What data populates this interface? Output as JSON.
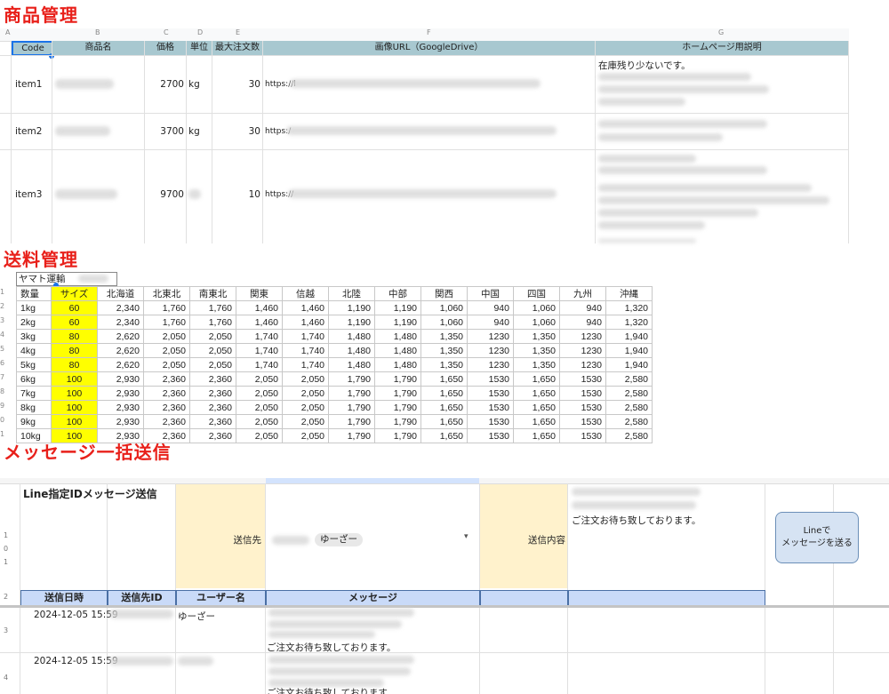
{
  "sections": {
    "product_title": "商品管理",
    "shipping_title": "送料管理",
    "message_title": "メッセージ一括送信"
  },
  "products": {
    "column_letters": [
      "A",
      "B",
      "C",
      "D",
      "E",
      "F",
      "G"
    ],
    "headers": [
      "Code",
      "商品名",
      "価格",
      "単位",
      "最大注文数",
      "画像URL（GoogleDrive）",
      "ホームページ用説明"
    ],
    "rows": [
      {
        "code": "item1",
        "price": "2700",
        "unit": "kg",
        "max": "30",
        "url": "https://l",
        "desc": "在庫残り少ないです。"
      },
      {
        "code": "item2",
        "price": "3700",
        "unit": "kg",
        "max": "30",
        "url": "https:/",
        "desc": ""
      },
      {
        "code": "item3",
        "price": "9700",
        "unit": "",
        "max": "10",
        "url": "https://",
        "desc": ""
      }
    ]
  },
  "shipping": {
    "carrier": "ヤマト運輸",
    "headers": [
      "数量",
      "サイズ",
      "北海道",
      "北東北",
      "南東北",
      "関東",
      "信越",
      "北陸",
      "中部",
      "関西",
      "中国",
      "四国",
      "九州",
      "沖縄"
    ],
    "row_numbers": [
      "1",
      "2",
      "3",
      "4",
      "5",
      "6",
      "7",
      "8",
      "9",
      "0",
      "1"
    ],
    "rows": [
      [
        "1kg",
        "60",
        "2,340",
        "1,760",
        "1,760",
        "1,460",
        "1,460",
        "1,190",
        "1,190",
        "1,060",
        "940",
        "1,060",
        "940",
        "1,320"
      ],
      [
        "2kg",
        "60",
        "2,340",
        "1,760",
        "1,760",
        "1,460",
        "1,460",
        "1,190",
        "1,190",
        "1,060",
        "940",
        "1,060",
        "940",
        "1,320"
      ],
      [
        "3kg",
        "80",
        "2,620",
        "2,050",
        "2,050",
        "1,740",
        "1,740",
        "1,480",
        "1,480",
        "1,350",
        "1230",
        "1,350",
        "1230",
        "1,940"
      ],
      [
        "4kg",
        "80",
        "2,620",
        "2,050",
        "2,050",
        "1,740",
        "1,740",
        "1,480",
        "1,480",
        "1,350",
        "1230",
        "1,350",
        "1230",
        "1,940"
      ],
      [
        "5kg",
        "80",
        "2,620",
        "2,050",
        "2,050",
        "1,740",
        "1,740",
        "1,480",
        "1,480",
        "1,350",
        "1230",
        "1,350",
        "1230",
        "1,940"
      ],
      [
        "6kg",
        "100",
        "2,930",
        "2,360",
        "2,360",
        "2,050",
        "2,050",
        "1,790",
        "1,790",
        "1,650",
        "1530",
        "1,650",
        "1530",
        "2,580"
      ],
      [
        "7kg",
        "100",
        "2,930",
        "2,360",
        "2,360",
        "2,050",
        "2,050",
        "1,790",
        "1,790",
        "1,650",
        "1530",
        "1,650",
        "1530",
        "2,580"
      ],
      [
        "8kg",
        "100",
        "2,930",
        "2,360",
        "2,360",
        "2,050",
        "2,050",
        "1,790",
        "1,790",
        "1,650",
        "1530",
        "1,650",
        "1530",
        "2,580"
      ],
      [
        "9kg",
        "100",
        "2,930",
        "2,360",
        "2,360",
        "2,050",
        "2,050",
        "1,790",
        "1,790",
        "1,650",
        "1530",
        "1,650",
        "1530",
        "2,580"
      ],
      [
        "10kg",
        "100",
        "2,930",
        "2,360",
        "2,360",
        "2,050",
        "2,050",
        "1,790",
        "1,790",
        "1,650",
        "1530",
        "1,650",
        "1530",
        "2,580"
      ]
    ]
  },
  "messaging": {
    "panel_title": "Line指定IDメッセージ送信",
    "recipient_label": "送信先",
    "recipient_value": "ゆーざー",
    "content_label": "送信内容",
    "content_value": "ご注文お待ち致しております。",
    "send_button_line1": "Lineで",
    "send_button_line2": "メッセージを送る",
    "row_numbers": [
      "1",
      "0",
      "1",
      "2",
      "3",
      "4"
    ],
    "log_headers": [
      "送信日時",
      "送信先ID",
      "ユーザー名",
      "メッセージ"
    ],
    "log_rows": [
      {
        "date": "2024-12-05 15:59",
        "user": "ゆーざー",
        "message": "ご注文お待ち致しております。"
      },
      {
        "date": "2024-12-05 15:59",
        "user": "",
        "message": "ご注文お待ち致しております。"
      }
    ]
  }
}
